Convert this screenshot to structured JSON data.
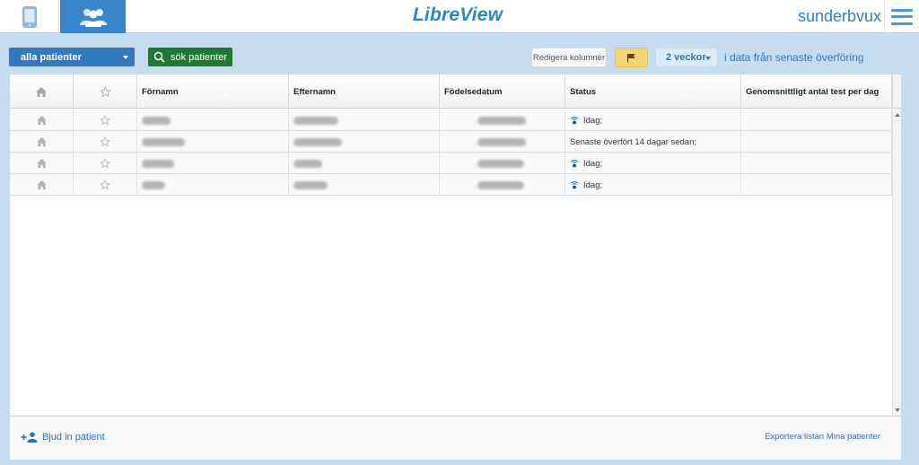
{
  "app": {
    "logo": "LibreView",
    "username": "sunderbvux"
  },
  "nav": {
    "device_icon": "phone-icon",
    "patients_icon": "users-icon",
    "menu_icon": "hamburger-icon"
  },
  "toolbar": {
    "filter_label": "alla patienter",
    "search_label": "sök patienter",
    "edit_columns_label": "Redigera kolumner",
    "flag_icon": "flag-icon",
    "period_label": "2 veckor",
    "period_suffix": "i data från senaste överföring"
  },
  "table": {
    "columns": [
      "",
      "",
      "Förnamn",
      "Efternamn",
      "Födelsedatum",
      "Status",
      "Genomsnittligt antal test per dag"
    ],
    "rows": [
      {
        "status": "Idag;",
        "signal": true
      },
      {
        "status": "Senaste överfört 14 dagar sedan;",
        "signal": false
      },
      {
        "status": "Idag;",
        "signal": true
      },
      {
        "status": "Idag;",
        "signal": true
      }
    ]
  },
  "footer": {
    "invite_label": "Bjud in patient",
    "export_label": "Exportera listan Mina patienter"
  },
  "colors": {
    "primary_blue": "#3478bf",
    "search_green": "#1e7a32",
    "flag_yellow": "#f4d773",
    "background": "#c6dcef"
  }
}
